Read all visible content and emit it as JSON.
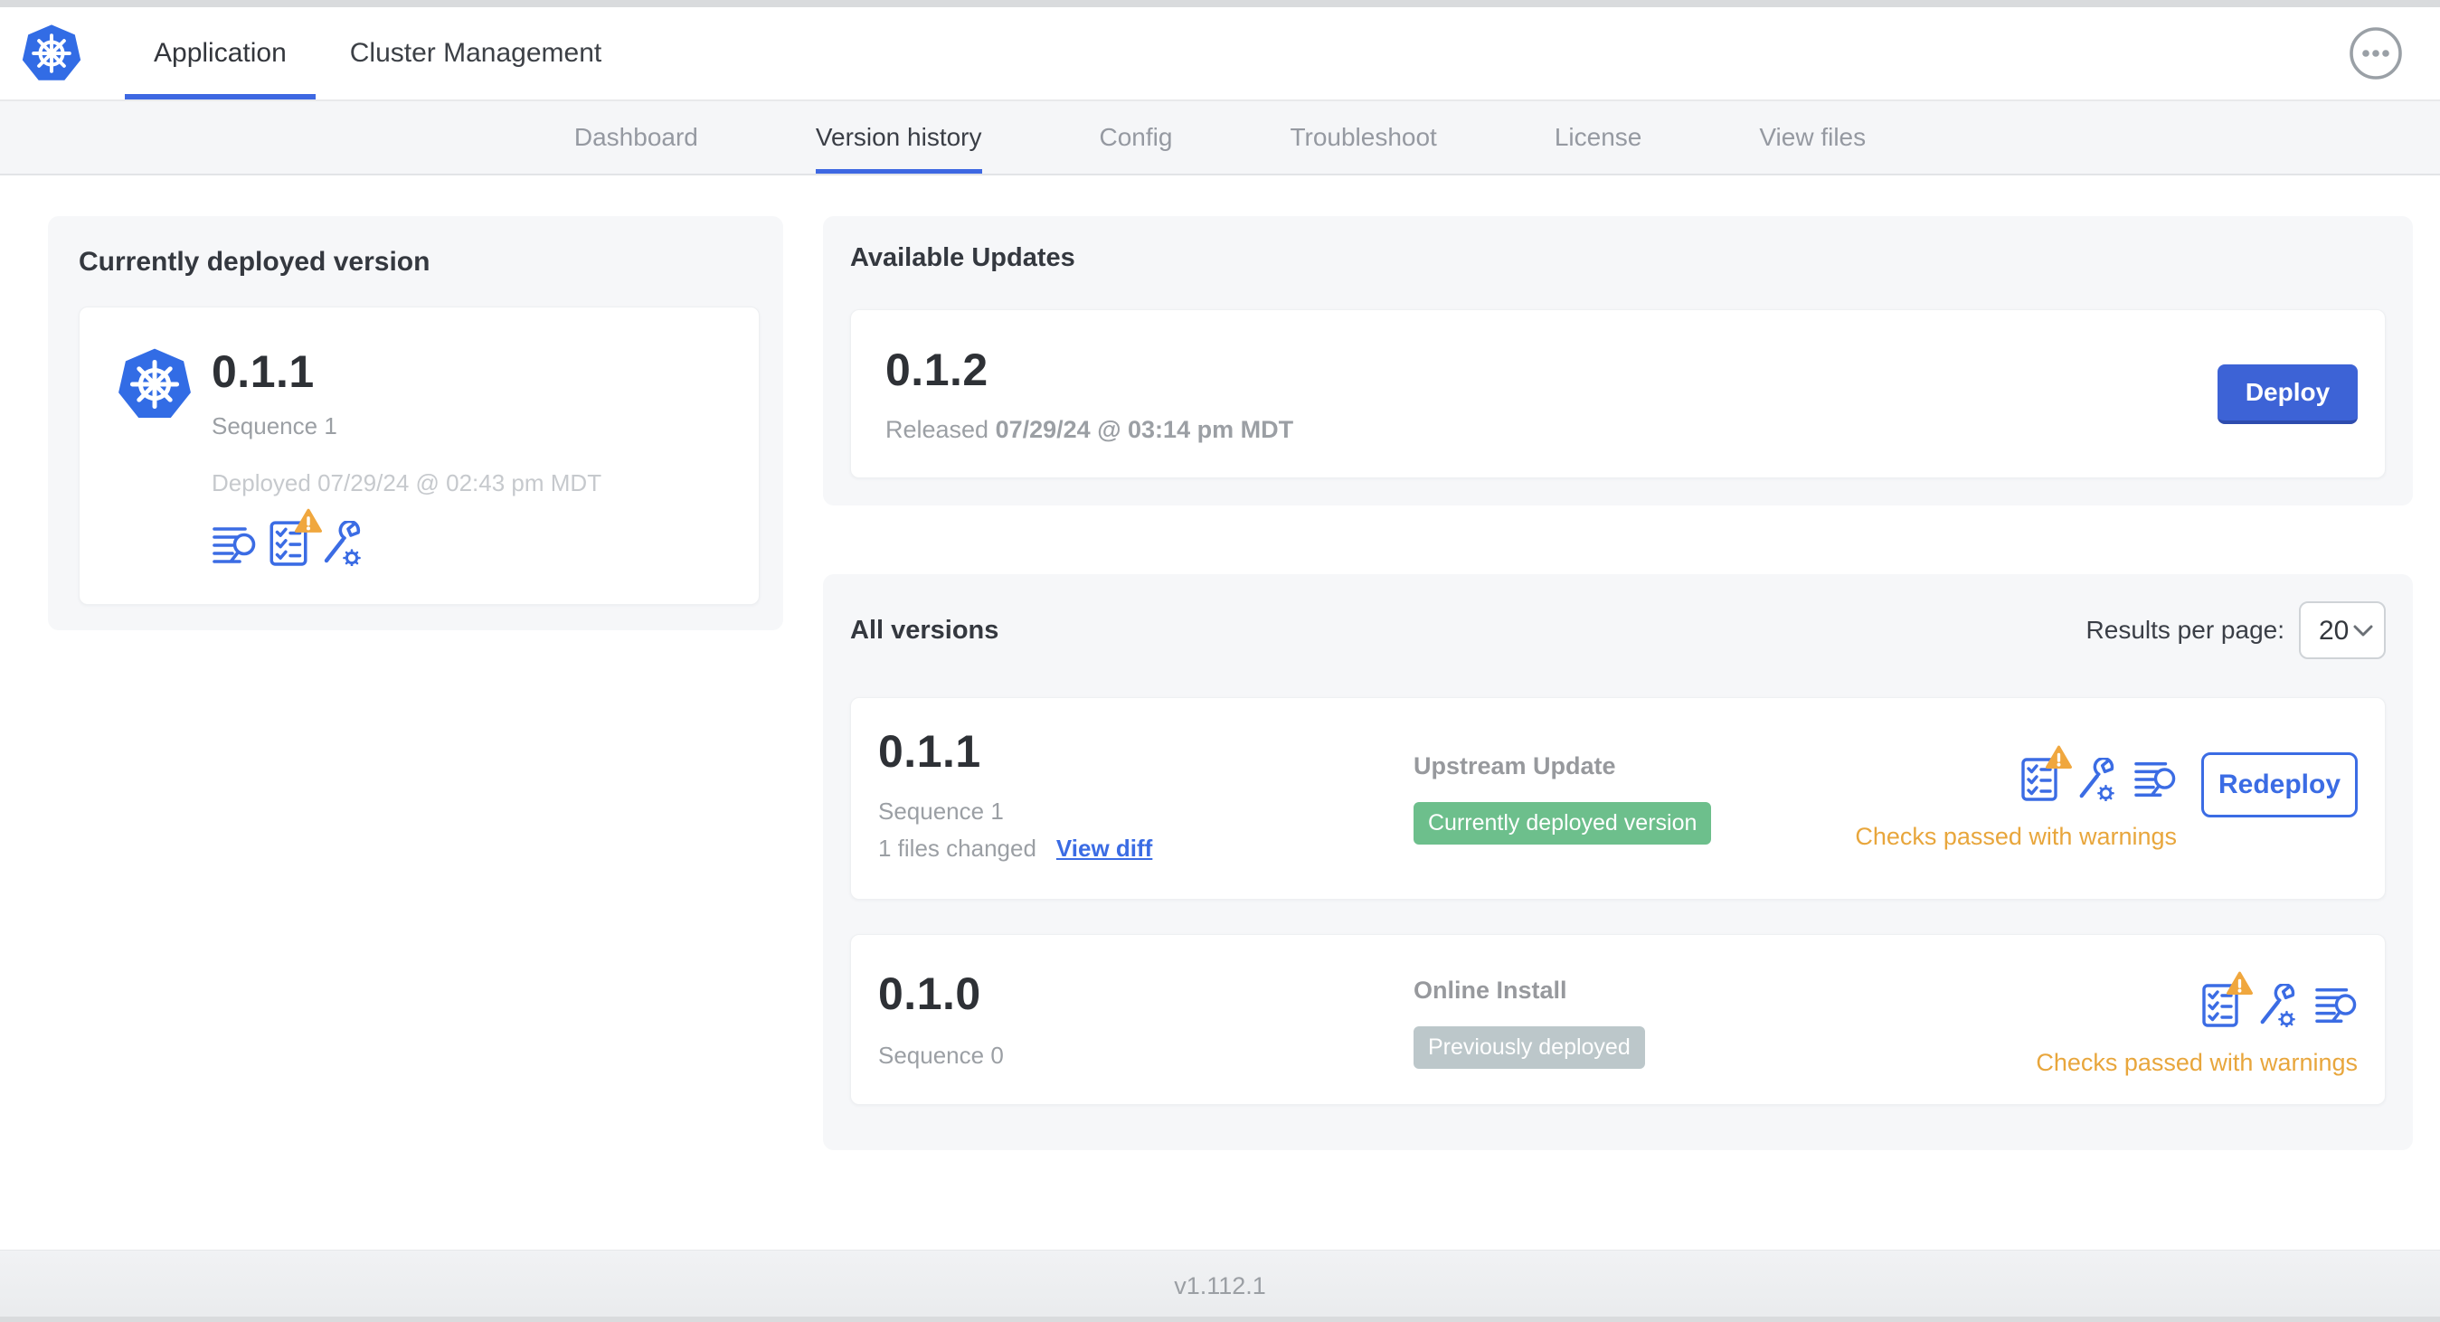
{
  "header": {
    "tabs": [
      {
        "label": "Application",
        "active": true
      },
      {
        "label": "Cluster Management",
        "active": false
      }
    ]
  },
  "subnav": {
    "tabs": [
      {
        "label": "Dashboard",
        "active": false
      },
      {
        "label": "Version history",
        "active": true
      },
      {
        "label": "Config",
        "active": false
      },
      {
        "label": "Troubleshoot",
        "active": false
      },
      {
        "label": "License",
        "active": false
      },
      {
        "label": "View files",
        "active": false
      }
    ]
  },
  "current_version": {
    "title": "Currently deployed version",
    "version": "0.1.1",
    "sequence": "Sequence 1",
    "deployed_prefix": "Deployed ",
    "deployed_date": "07/29/24 @ 02:43 pm MDT"
  },
  "available_updates": {
    "title": "Available Updates",
    "version": "0.1.2",
    "released_prefix": "Released ",
    "released_date": "07/29/24 @ 03:14 pm MDT",
    "deploy_label": "Deploy"
  },
  "all_versions": {
    "title": "All versions",
    "results_per_page_label": "Results per page:",
    "results_per_page_value": "20",
    "rows": [
      {
        "version": "0.1.1",
        "sequence": "Sequence 1",
        "files_changed": "1 files changed",
        "view_diff_label": "View diff",
        "source": "Upstream Update",
        "badge": "Currently deployed version",
        "badge_type": "green",
        "status": "Checks passed with warnings",
        "action_label": "Redeploy"
      },
      {
        "version": "0.1.0",
        "sequence": "Sequence 0",
        "source": "Online Install",
        "badge": "Previously deployed",
        "badge_type": "gray",
        "status": "Checks passed with warnings"
      }
    ]
  },
  "footer": {
    "version": "v1.112.1"
  },
  "icons": {
    "logo": "kubernetes-logo",
    "menu": "ellipsis-icon",
    "row_icons": [
      "checklist-warning-icon",
      "wrench-gear-icon",
      "log-search-icon"
    ]
  },
  "colors": {
    "accent_blue": "#3b6ce4",
    "button_blue": "#3d63d6",
    "k8s_blue": "#326ce5",
    "success_green": "#6dbf8c",
    "neutral_badge_gray": "#bcc7ca",
    "warning_orange": "#e8a63c",
    "subnav_bg": "#f5f6f8",
    "panel_bg": "#f6f7f9"
  }
}
